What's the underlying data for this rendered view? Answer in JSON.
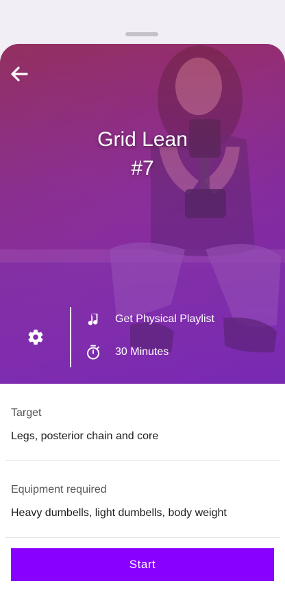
{
  "workout": {
    "title": "Grid Lean",
    "number": "#7",
    "playlist": "Get Physical Playlist",
    "duration": "30 Minutes"
  },
  "details": {
    "target_label": "Target",
    "target_value": "Legs, posterior chain and core",
    "equipment_label": "Equipment required",
    "equipment_value": "Heavy dumbells, light dumbells, body weight"
  },
  "actions": {
    "start_label": "Start"
  },
  "icons": {
    "back": "arrow-left-icon",
    "settings": "gear-icon",
    "music": "music-note-icon",
    "timer": "stopwatch-icon"
  },
  "colors": {
    "overlay_top": "#9b2d52",
    "overlay_mid": "#8a2d9e",
    "overlay_bottom": "#7a23b8",
    "accent": "#8800ff"
  }
}
